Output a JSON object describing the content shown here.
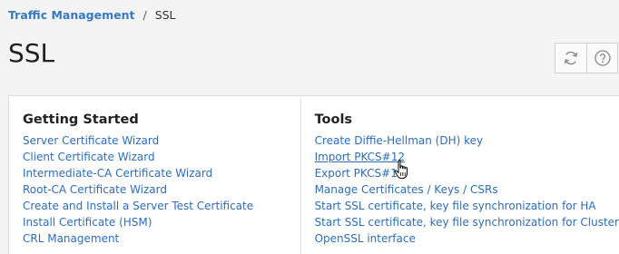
{
  "breadcrumb": {
    "parent": "Traffic Management",
    "separator": "/",
    "current": "SSL"
  },
  "page": {
    "title": "SSL"
  },
  "toolbar": {
    "refresh_icon": "refresh-icon",
    "help_icon": "help-icon"
  },
  "getting_started": {
    "heading": "Getting Started",
    "links": [
      "Server Certificate Wizard",
      "Client Certificate Wizard",
      "Intermediate-CA Certificate Wizard",
      "Root-CA Certificate Wizard",
      "Create and Install a Server Test Certificate",
      "Install Certificate (HSM)",
      "CRL Management"
    ]
  },
  "tools": {
    "heading": "Tools",
    "links": [
      "Create Diffie-Hellman (DH) key",
      "Import PKCS#12",
      "Export PKCS#12",
      "Manage Certificates / Keys / CSRs",
      "Start SSL certificate, key file synchronization for HA",
      "Start SSL certificate, key file synchronization for Cluster",
      "OpenSSL interface"
    ]
  },
  "colors": {
    "link": "#2e6db4",
    "breadcrumb_link": "#3779c1"
  }
}
